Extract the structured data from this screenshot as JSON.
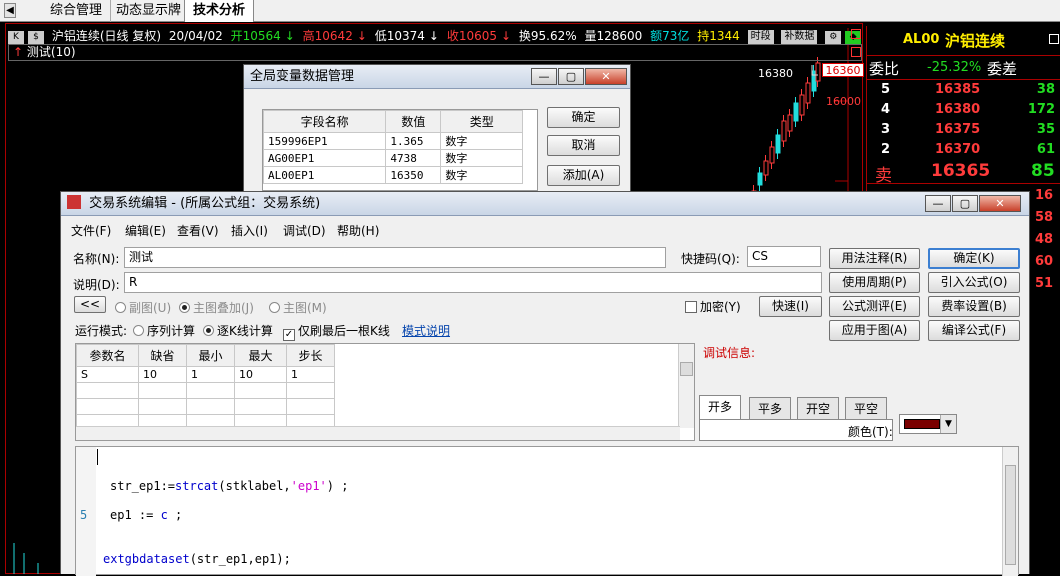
{
  "tabs": [
    "综合管理",
    "动态显示牌",
    "技术分析"
  ],
  "info": {
    "title": "沪铝连续(日线 复权)",
    "date": "20/04/02",
    "open": "开10564",
    "high": "高10642",
    "low": "低10374",
    "close": "收10605",
    "turnover": "换95.62%",
    "volume": "量128600",
    "amount": "额73亿",
    "hold": "持1344",
    "btn_period": "时段",
    "btn_fill": "补数据",
    "indicator": "测试(10)"
  },
  "chart": {
    "price_high": "16380",
    "price_tag": "16360",
    "price_16000": "16000"
  },
  "quote": {
    "code": "AL00",
    "name": "沪铝连续",
    "wei_bi_label": "委比",
    "wei_bi_value": "-25.32%",
    "wei_cha_label": "委差",
    "sell_label": "卖",
    "rows": [
      {
        "level": "5",
        "price": "16385",
        "vol": "38"
      },
      {
        "level": "4",
        "price": "16380",
        "vol": "172"
      },
      {
        "level": "3",
        "price": "16375",
        "vol": "35"
      },
      {
        "level": "2",
        "price": "16370",
        "vol": "61"
      }
    ],
    "sell1_price": "16365",
    "sell1_vol": "85",
    "tail": [
      "16",
      "58",
      "48",
      "60",
      "51"
    ]
  },
  "var_dialog": {
    "title": "全局变量数据管理",
    "headers": [
      "字段名称",
      "数值",
      "类型"
    ],
    "rows": [
      [
        "159996EP1",
        "1.365",
        "数字"
      ],
      [
        "AG00EP1",
        "4738",
        "数字"
      ],
      [
        "AL00EP1",
        "16350",
        "数字"
      ]
    ],
    "ok": "确定",
    "cancel": "取消",
    "add": "添加(A)"
  },
  "editor": {
    "title": "交易系统编辑 - (所属公式组：交易系统)",
    "menu": [
      "文件(F)",
      "编辑(E)",
      "查看(V)",
      "插入(I)",
      "调试(D)",
      "帮助(H)"
    ],
    "name_label": "名称(N):",
    "name_value": "测试",
    "shortcut_label": "快捷码(Q):",
    "shortcut_value": "CS",
    "desc_label": "说明(D):",
    "desc_value": "R",
    "collapse": "<<",
    "radio_sub": "副图(U)",
    "radio_overlay": "主图叠加(J)",
    "radio_main": "主图(M)",
    "encrypt": "加密(Y)",
    "fast": "快速(I)",
    "run_mode_label": "运行模式:",
    "mode_seq": "序列计算",
    "mode_kline": "逐K线计算",
    "only_last": "仅刷最后一根K线",
    "mode_help": "模式说明",
    "params_headers": [
      "参数名",
      "缺省",
      "最小",
      "最大",
      "步长"
    ],
    "params_rows": [
      [
        "S",
        "10",
        "1",
        "10",
        "1"
      ]
    ],
    "debug_label": "调试信息:",
    "pos_tabs": [
      "开多",
      "平多",
      "开空",
      "平空"
    ],
    "color_label": "颜色(T):",
    "color_value": "#7a0000",
    "buttons_left": [
      "用法注释(R)",
      "使用周期(P)",
      "公式测评(E)",
      "应用于图(A)"
    ],
    "buttons_right": [
      "确定(K)",
      "引入公式(O)",
      "费率设置(B)",
      "编译公式(F)"
    ],
    "code": {
      "line1_var": "str_ep1:=",
      "line1_fn": "strcat",
      "line1_args_a": "(stklabel,",
      "line1_str": "'ep1'",
      "line1_end": ") ;",
      "line_num_5": "5",
      "line2_a": "ep1 := ",
      "line2_fn": "c",
      "line2_end": " ;",
      "line3_fn": "extgbdataset",
      "line3_args": "(str_ep1,ep1);"
    }
  }
}
